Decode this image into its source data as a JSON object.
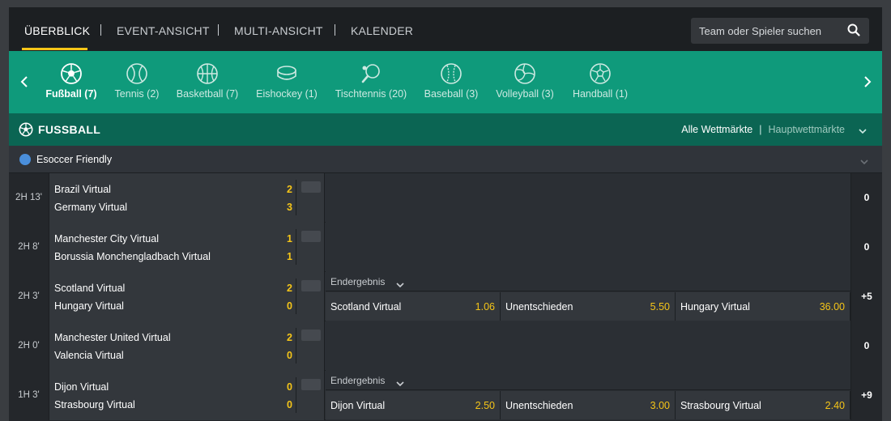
{
  "nav": {
    "items": [
      {
        "label": "ÜBERBLICK",
        "active": true
      },
      {
        "label": "EVENT-ANSICHT",
        "active": false
      },
      {
        "label": "MULTI-ANSICHT",
        "active": false
      },
      {
        "label": "KALENDER",
        "active": false
      }
    ],
    "search_placeholder": "Team oder Spieler suchen"
  },
  "sports": [
    {
      "label": "Fußball (7)",
      "icon": "soccer-ball-icon",
      "active": true
    },
    {
      "label": "Tennis (2)",
      "icon": "tennis-ball-icon",
      "active": false
    },
    {
      "label": "Basketball (7)",
      "icon": "basketball-icon",
      "active": false
    },
    {
      "label": "Eishockey (1)",
      "icon": "hockey-puck-icon",
      "active": false
    },
    {
      "label": "Tischtennis (20)",
      "icon": "table-tennis-icon",
      "active": false
    },
    {
      "label": "Baseball (3)",
      "icon": "baseball-icon",
      "active": false
    },
    {
      "label": "Volleyball (3)",
      "icon": "volleyball-icon",
      "active": false
    },
    {
      "label": "Handball (1)",
      "icon": "handball-icon",
      "active": false
    }
  ],
  "section": {
    "title": "FUSSBALL",
    "all_markets": "Alle Wettmärkte",
    "separator": "|",
    "main_markets": "Hauptwettmärkte"
  },
  "league": {
    "name": "Esoccer Friendly"
  },
  "matches": [
    {
      "time": "2H 13'",
      "home": "Brazil Virtual",
      "away": "Germany Virtual",
      "home_score": "2",
      "away_score": "3",
      "more": "0",
      "market": null
    },
    {
      "time": "2H 8'",
      "home": "Manchester City Virtual",
      "away": "Borussia Monchengladbach Virtual",
      "home_score": "1",
      "away_score": "1",
      "more": "0",
      "market": null
    },
    {
      "time": "2H 3'",
      "home": "Scotland Virtual",
      "away": "Hungary Virtual",
      "home_score": "2",
      "away_score": "0",
      "more": "+5",
      "market": {
        "title": "Endergebnis",
        "odds": [
          {
            "name": "Scotland Virtual",
            "value": "1.06"
          },
          {
            "name": "Unentschieden",
            "value": "5.50"
          },
          {
            "name": "Hungary Virtual",
            "value": "36.00"
          }
        ]
      }
    },
    {
      "time": "2H 0'",
      "home": "Manchester United Virtual",
      "away": "Valencia Virtual",
      "home_score": "2",
      "away_score": "0",
      "more": "0",
      "market": null
    },
    {
      "time": "1H 3'",
      "home": "Dijon Virtual",
      "away": "Strasbourg Virtual",
      "home_score": "0",
      "away_score": "0",
      "more": "+9",
      "market": {
        "title": "Endergebnis",
        "odds": [
          {
            "name": "Dijon Virtual",
            "value": "2.50"
          },
          {
            "name": "Unentschieden",
            "value": "3.00"
          },
          {
            "name": "Strasbourg Virtual",
            "value": "2.40"
          }
        ]
      }
    }
  ],
  "colors": {
    "accent": "#f5c518",
    "sportsbar": "#0f9a7b",
    "section": "#0b6553"
  }
}
